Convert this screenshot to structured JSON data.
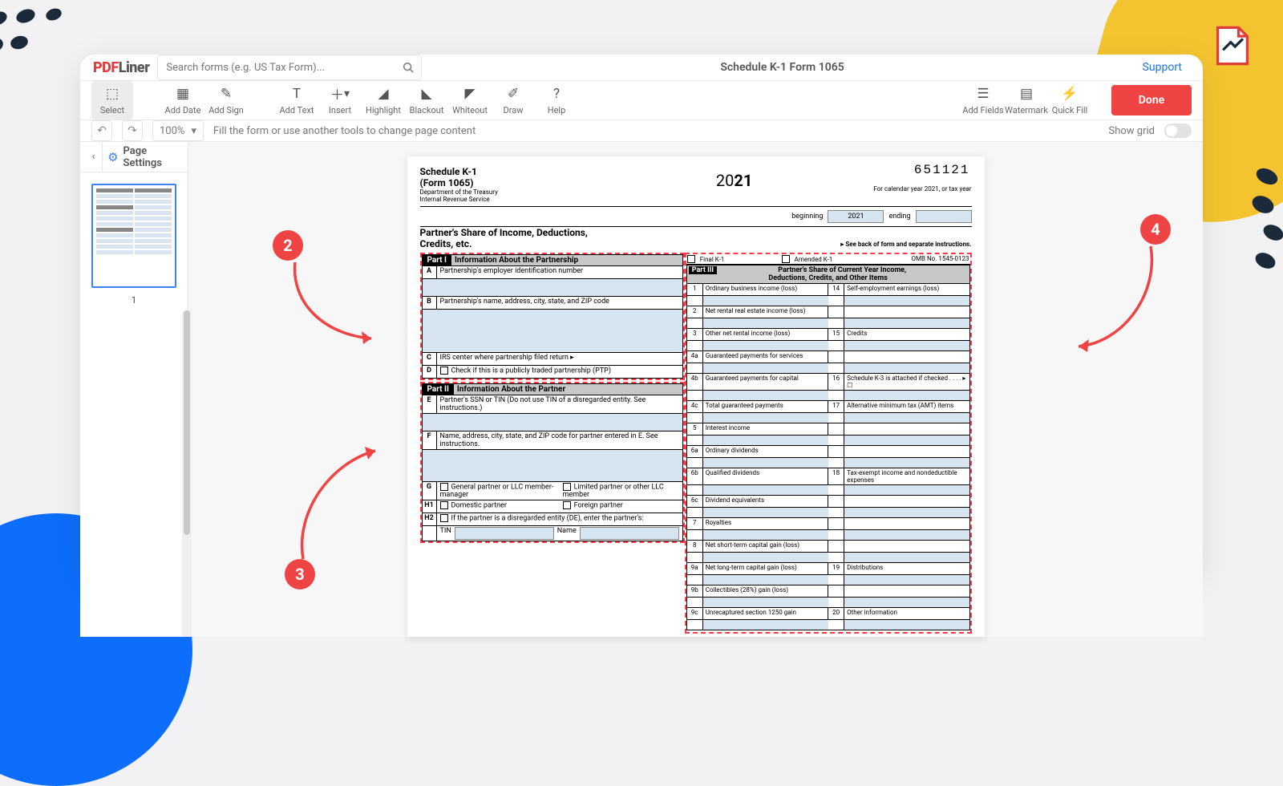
{
  "header": {
    "logo_pre": "PDF",
    "logo_post": "Liner",
    "search_placeholder": "Search forms (e.g. US Tax Form)...",
    "doc_title": "Schedule K-1 Form 1065",
    "support": "Support"
  },
  "toolbar": {
    "select": "Select",
    "add_date": "Add Date",
    "add_sign": "Add Sign",
    "add_text": "Add Text",
    "insert": "Insert",
    "highlight": "Highlight",
    "blackout": "Blackout",
    "whiteout": "Whiteout",
    "draw": "Draw",
    "help": "Help",
    "add_fields": "Add Fields",
    "watermark": "Watermark",
    "quick_fill": "Quick Fill",
    "done": "Done"
  },
  "subbar": {
    "zoom": "100%",
    "hint": "Fill the form or use another tools to change page content",
    "show_grid": "Show grid"
  },
  "sidebar": {
    "page_settings": "Page Settings",
    "thumb_label": "1"
  },
  "form": {
    "num": "651121",
    "sched": "Schedule K-1",
    "form_no": "(Form 1065)",
    "dept": "Department of the Treasury",
    "irs": "Internal Revenue Service",
    "year_pre": "20",
    "year_bold": "21",
    "cal_text": "For calendar year 2021, or tax year",
    "beginning": "beginning",
    "ending": "ending",
    "year_input": "2021",
    "share_title": "Partner's Share of Income, Deductions,",
    "share_title2": "Credits, etc.",
    "see_back": "▸ See back of form and separate instructions.",
    "final_k1": "Final K-1",
    "amended_k1": "Amended K-1",
    "omb": "OMB No. 1545-0123",
    "part1": {
      "label": "Part I",
      "title": "Information About the Partnership",
      "A": "Partnership's employer identification number",
      "B": "Partnership's name, address, city, state, and ZIP code",
      "C": "IRS center where partnership filed return ▸",
      "D": "Check if this is a publicly traded partnership (PTP)"
    },
    "part2": {
      "label": "Part II",
      "title": "Information About the Partner",
      "E": "Partner's SSN or TIN (Do not use TIN of a disregarded entity. See instructions.)",
      "F": "Name, address, city, state, and ZIP code for partner entered in E. See instructions.",
      "G1": "General partner or LLC member-manager",
      "G2": "Limited partner or other LLC member",
      "H1a": "Domestic partner",
      "H1b": "Foreign partner",
      "H2": "If the partner is a disregarded entity (DE), enter the partner's:",
      "TIN": "TIN",
      "Name": "Name"
    },
    "part3": {
      "label": "Part III",
      "t1": "Partner's Share of Current Year Income,",
      "t2": "Deductions, Credits, and Other Items",
      "lines_left": [
        {
          "n": "1",
          "t": "Ordinary business income (loss)"
        },
        {
          "n": "2",
          "t": "Net rental real estate income (loss)"
        },
        {
          "n": "3",
          "t": "Other net rental income (loss)"
        },
        {
          "n": "4a",
          "t": "Guaranteed payments for services"
        },
        {
          "n": "4b",
          "t": "Guaranteed payments for capital"
        },
        {
          "n": "4c",
          "t": "Total guaranteed payments"
        },
        {
          "n": "5",
          "t": "Interest income"
        },
        {
          "n": "6a",
          "t": "Ordinary dividends"
        },
        {
          "n": "6b",
          "t": "Qualified dividends"
        },
        {
          "n": "6c",
          "t": "Dividend equivalents"
        },
        {
          "n": "7",
          "t": "Royalties"
        },
        {
          "n": "8",
          "t": "Net short-term capital gain (loss)"
        },
        {
          "n": "9a",
          "t": "Net long-term capital gain (loss)"
        },
        {
          "n": "9b",
          "t": "Collectibles (28%) gain (loss)"
        },
        {
          "n": "9c",
          "t": "Unrecaptured section 1250 gain"
        }
      ],
      "lines_right": [
        {
          "n": "14",
          "t": "Self-employment earnings (loss)"
        },
        {
          "n": "",
          "t": ""
        },
        {
          "n": "15",
          "t": "Credits"
        },
        {
          "n": "",
          "t": ""
        },
        {
          "n": "16",
          "t": "Schedule K-3 is attached if checked . . . . ▸ ☐"
        },
        {
          "n": "17",
          "t": "Alternative minimum tax (AMT) items"
        },
        {
          "n": "",
          "t": ""
        },
        {
          "n": "",
          "t": ""
        },
        {
          "n": "18",
          "t": "Tax-exempt income and nondeductible expenses"
        },
        {
          "n": "",
          "t": ""
        },
        {
          "n": "",
          "t": ""
        },
        {
          "n": "",
          "t": ""
        },
        {
          "n": "19",
          "t": "Distributions"
        },
        {
          "n": "",
          "t": ""
        },
        {
          "n": "20",
          "t": "Other information"
        }
      ]
    }
  },
  "callouts": {
    "c2": "2",
    "c3": "3",
    "c4": "4"
  }
}
